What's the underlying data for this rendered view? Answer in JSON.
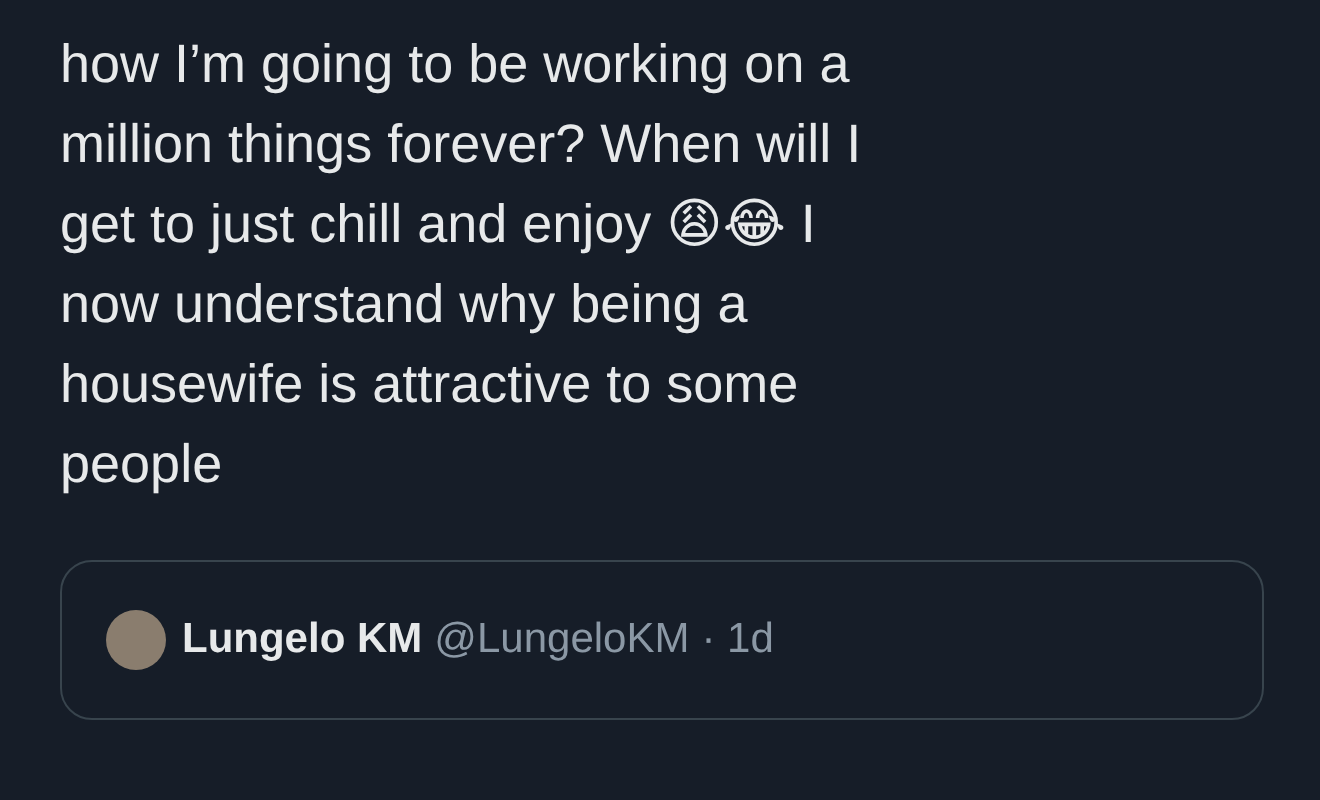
{
  "tweet": {
    "lines": [
      "how I’m going to be working on a",
      "million things forever? When will I",
      "get to just chill and enjoy 😩😂 I",
      "now understand why being a",
      "housewife is attractive to some",
      "people"
    ]
  },
  "quoted_tweet": {
    "name": "Lungelo KM",
    "handle": "@LungeloKM",
    "time": "· 1d"
  }
}
